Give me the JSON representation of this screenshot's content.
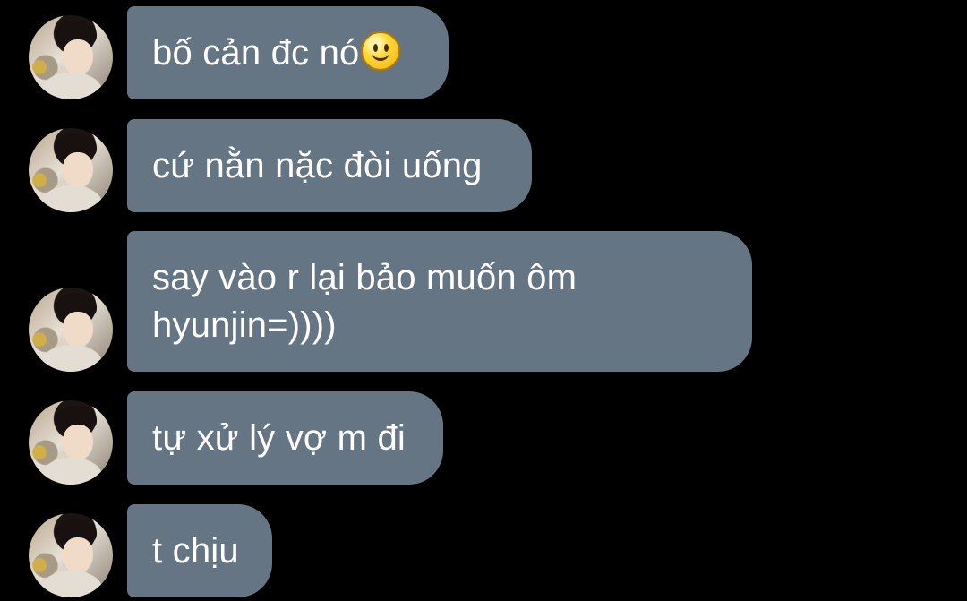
{
  "chat": {
    "messages": [
      {
        "text": "bố cản đc nó",
        "emoji": "slightly-smiling-face-icon"
      },
      {
        "text": "cứ nằn nặc đòi uống"
      },
      {
        "text": "say vào r lại bảo muốn ôm\nhyunjin=))))"
      },
      {
        "text": "tự xử lý vợ m đi"
      },
      {
        "text": "t chịu"
      }
    ]
  },
  "colors": {
    "background": "#000000",
    "bubble": "#667584",
    "text": "#ffffff"
  }
}
